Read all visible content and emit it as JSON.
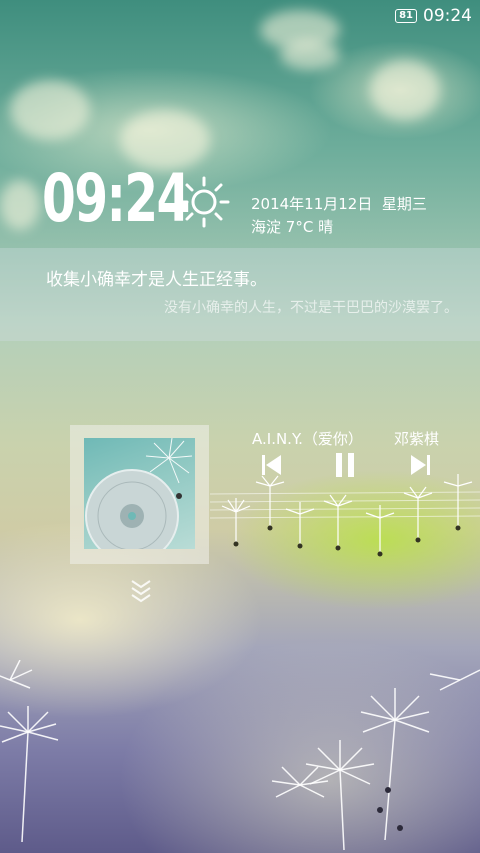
{
  "status_bar": {
    "battery_level": "81",
    "time": "09:24"
  },
  "lock_clock": {
    "time": "09:24",
    "weather_icon": "sun-icon",
    "date": "2014年11月12日",
    "weekday": "星期三",
    "location": "海淀",
    "temperature": "7°C",
    "condition": "晴"
  },
  "quote": {
    "main": "收集小确幸才是人生正经事。",
    "sub": "没有小确幸的人生，不过是干巴巴的沙漠罢了。"
  },
  "music": {
    "song_title": "A.I.N.Y.（爱你）",
    "artist": "邓紫棋",
    "controls": [
      "previous-icon",
      "pause-icon",
      "next-icon"
    ],
    "album_art": "album-cover"
  },
  "unlock_hint": "chevron-down-icon",
  "colors": {
    "top": "#3f8e7e",
    "bottom": "#5e5b8a",
    "accent_green": "#b9e146"
  }
}
